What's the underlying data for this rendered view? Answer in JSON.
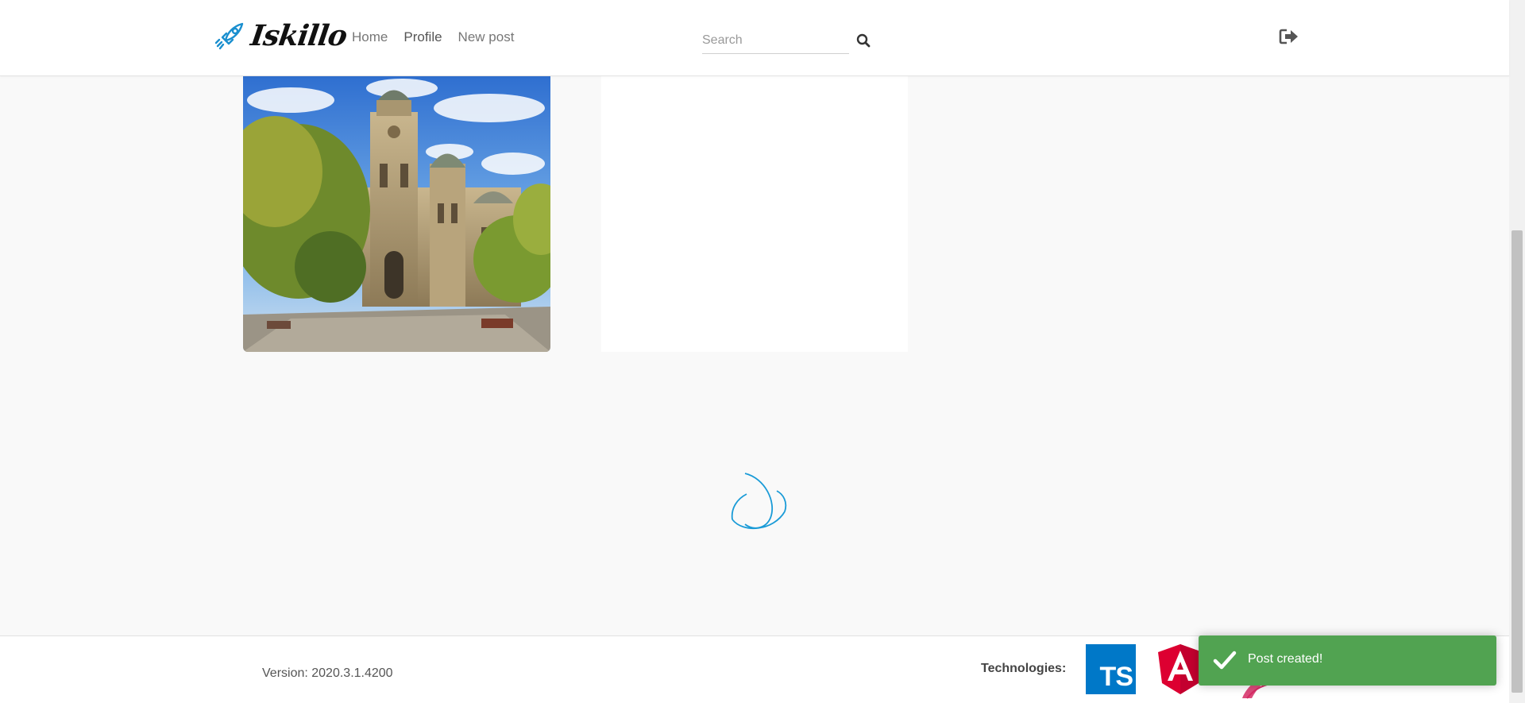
{
  "navbar": {
    "brand": "Iskillo",
    "links": [
      "Home",
      "Profile",
      "New post"
    ],
    "active_link": "Profile",
    "search": {
      "placeholder": "Search",
      "value": ""
    },
    "icons": {
      "search": "search-icon",
      "logout": "sign-out-icon",
      "logo": "rocket-icon"
    }
  },
  "posts": [
    {
      "type": "image",
      "description_icon": "cathedral-photo"
    },
    {
      "type": "blank"
    }
  ],
  "loading": {
    "icon": "spinner-icon"
  },
  "footer": {
    "version": "Version: 2020.3.1.4200",
    "technologies_label": "Technologies:",
    "logos": [
      {
        "name": "typescript-logo",
        "text": "TS",
        "color": "#0078c8"
      },
      {
        "name": "angular-logo",
        "text": "A",
        "color": "#dd0031"
      },
      {
        "name": "ngrx-logo",
        "color": "#d62b65"
      }
    ]
  },
  "toast": {
    "message": "Post created!",
    "icon": "check-icon",
    "color": "#51a351"
  },
  "colors": {
    "accent": "#1a9bd7",
    "toast_success": "#51a351",
    "background": "#f9f9f9"
  }
}
